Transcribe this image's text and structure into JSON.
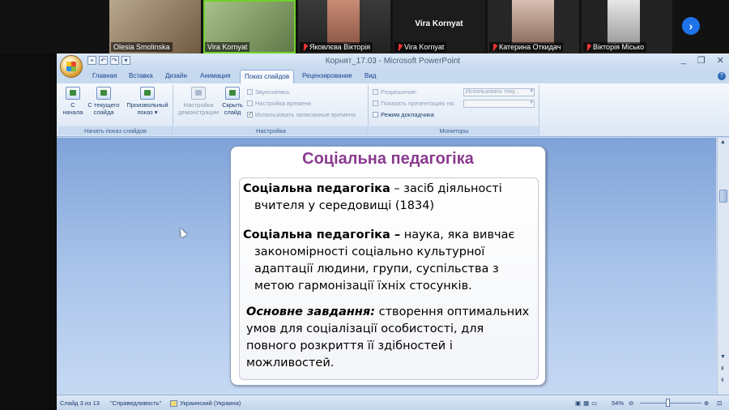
{
  "meeting": {
    "participants": [
      {
        "name": "Olesia Smolinska",
        "muted": false
      },
      {
        "name": "Vira Kornyat",
        "muted": false
      },
      {
        "name": "Яковлєва Вікторія",
        "muted": true
      },
      {
        "name": "Vira Kornyat",
        "muted": true
      },
      {
        "name": "Катерина Откидач",
        "muted": true
      },
      {
        "name": "Вікторія Місько",
        "muted": true
      }
    ],
    "active_speaker_label": "Vira Kornyat",
    "next_page_icon": "chevron-right-icon"
  },
  "window": {
    "title": "Корнят_17.03 - Microsoft PowerPoint",
    "controls": [
      "_",
      "❐",
      "✕"
    ]
  },
  "ribbon": {
    "tabs": [
      "Главная",
      "Вставка",
      "Дизайн",
      "Анимация",
      "Показ слайдов",
      "Рецензирование",
      "Вид"
    ],
    "active_tab": "Показ слайдов",
    "group1": {
      "label": "Начать показ слайдов",
      "btn_from_start": [
        "С",
        "начала"
      ],
      "btn_from_current": [
        "С текущего",
        "слайда"
      ],
      "btn_custom": [
        "Произвольный",
        "показ ▾"
      ]
    },
    "group2": {
      "label": "Настройка",
      "btn_setup": [
        "Настройка",
        "демонстрации"
      ],
      "btn_hide": [
        "Скрыть",
        "слайд"
      ],
      "record": "Звукозапись",
      "rehearse": "Настройка времени",
      "use_timings": "Использовать записанные времена"
    },
    "group3": {
      "label": "Мониторы",
      "resolution_label": "Разрешение:",
      "resolution_value": "Использовать теку...",
      "show_on_label": "Показать презентацию на:",
      "presenter_view": "Режим докладчика"
    }
  },
  "slide": {
    "title": "Соціальна педагогіка",
    "p1_bold": "Соціальна педагогіка",
    "p1_line1": " – засіб діяльності",
    "p1_line2": "вчителя у середовищі (1834)",
    "p2_bold": "Соціальна педагогіка –",
    "p2_line1": " наука, яка вивчає",
    "p2_line2": "закономірності соціально культурної",
    "p2_line3": "адаптації людини, групи, суспільства з",
    "p2_line4": "метою гармонізації їхніх стосунків.",
    "p3_bold_italic": "Основне завдання:",
    "p3_line1": " створення оптимальних",
    "p3_line2": "умов для соціалізації особистості, для",
    "p3_line3": "повного розкриття її здібностей і",
    "p3_line4": "можливостей."
  },
  "status": {
    "slide_info": "Слайд 3 из 13",
    "theme": "\"Справедливость\"",
    "language": "Украинский (Украина)",
    "zoom": "54%"
  }
}
